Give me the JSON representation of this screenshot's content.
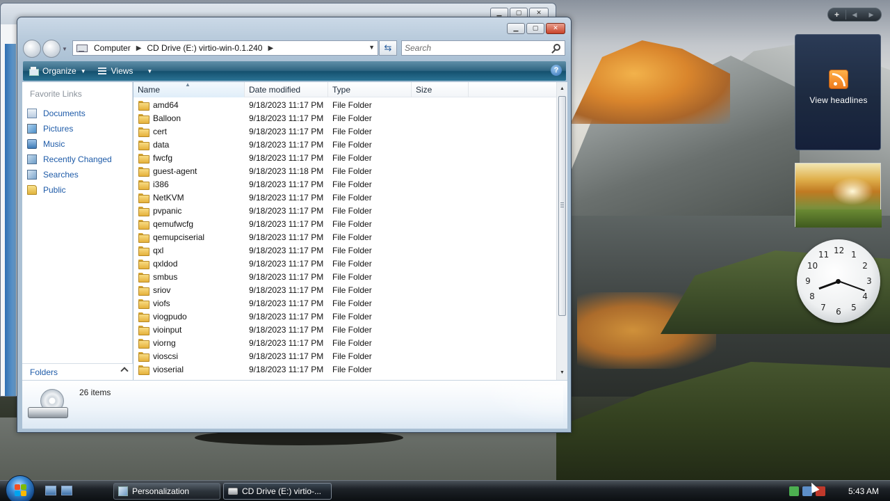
{
  "explorer": {
    "breadcrumb": [
      "Computer",
      "CD Drive (E:) virtio-win-0.1.240"
    ],
    "search_placeholder": "Search",
    "toolbar": {
      "organize": "Organize",
      "views": "Views"
    },
    "nav": {
      "heading": "Favorite Links",
      "items": [
        {
          "label": "Documents",
          "icon": "documents-icon"
        },
        {
          "label": "Pictures",
          "icon": "pictures-icon"
        },
        {
          "label": "Music",
          "icon": "music-icon"
        },
        {
          "label": "Recently Changed",
          "icon": "recently-changed-icon"
        },
        {
          "label": "Searches",
          "icon": "searches-icon"
        },
        {
          "label": "Public",
          "icon": "public-folder-icon"
        }
      ],
      "folders_label": "Folders"
    },
    "columns": {
      "name": "Name",
      "date": "Date modified",
      "type": "Type",
      "size": "Size"
    },
    "files": [
      {
        "name": "amd64",
        "date": "9/18/2023 11:17 PM",
        "type": "File Folder"
      },
      {
        "name": "Balloon",
        "date": "9/18/2023 11:17 PM",
        "type": "File Folder"
      },
      {
        "name": "cert",
        "date": "9/18/2023 11:17 PM",
        "type": "File Folder"
      },
      {
        "name": "data",
        "date": "9/18/2023 11:17 PM",
        "type": "File Folder"
      },
      {
        "name": "fwcfg",
        "date": "9/18/2023 11:17 PM",
        "type": "File Folder"
      },
      {
        "name": "guest-agent",
        "date": "9/18/2023 11:18 PM",
        "type": "File Folder"
      },
      {
        "name": "i386",
        "date": "9/18/2023 11:17 PM",
        "type": "File Folder"
      },
      {
        "name": "NetKVM",
        "date": "9/18/2023 11:17 PM",
        "type": "File Folder"
      },
      {
        "name": "pvpanic",
        "date": "9/18/2023 11:17 PM",
        "type": "File Folder"
      },
      {
        "name": "qemufwcfg",
        "date": "9/18/2023 11:17 PM",
        "type": "File Folder"
      },
      {
        "name": "qemupciserial",
        "date": "9/18/2023 11:17 PM",
        "type": "File Folder"
      },
      {
        "name": "qxl",
        "date": "9/18/2023 11:17 PM",
        "type": "File Folder"
      },
      {
        "name": "qxldod",
        "date": "9/18/2023 11:17 PM",
        "type": "File Folder"
      },
      {
        "name": "smbus",
        "date": "9/18/2023 11:17 PM",
        "type": "File Folder"
      },
      {
        "name": "sriov",
        "date": "9/18/2023 11:17 PM",
        "type": "File Folder"
      },
      {
        "name": "viofs",
        "date": "9/18/2023 11:17 PM",
        "type": "File Folder"
      },
      {
        "name": "viogpudo",
        "date": "9/18/2023 11:17 PM",
        "type": "File Folder"
      },
      {
        "name": "vioinput",
        "date": "9/18/2023 11:17 PM",
        "type": "File Folder"
      },
      {
        "name": "viorng",
        "date": "9/18/2023 11:17 PM",
        "type": "File Folder"
      },
      {
        "name": "vioscsi",
        "date": "9/18/2023 11:17 PM",
        "type": "File Folder"
      },
      {
        "name": "vioserial",
        "date": "9/18/2023 11:17 PM",
        "type": "File Folder"
      }
    ],
    "status": {
      "item_count": "26 items"
    }
  },
  "sidebar": {
    "feed_label": "View headlines"
  },
  "taskbar": {
    "buttons": [
      {
        "label": "Personalization",
        "icon": "personalization-icon"
      },
      {
        "label": "CD Drive (E:) virtio-...",
        "icon": "cd-drive-icon"
      }
    ],
    "clock": "5:43 AM"
  },
  "colors": {
    "link": "#1e5ba8",
    "toolbar": "#2f6582",
    "taskbar": "#1d2227"
  }
}
